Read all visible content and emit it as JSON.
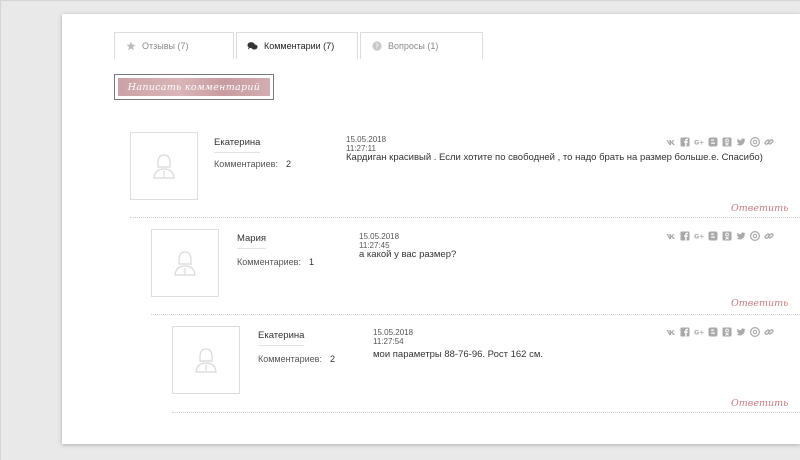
{
  "tabs": [
    {
      "label": "Отзывы (7)",
      "icon": "star-icon",
      "active": false
    },
    {
      "label": "Комментарии (7)",
      "icon": "chat-icon",
      "active": true
    },
    {
      "label": "Вопросы (1)",
      "icon": "question-icon",
      "active": false
    }
  ],
  "write_button": {
    "label": "Написать комментарий"
  },
  "comments_count_label": "Комментариев:",
  "reply_label": "Ответить",
  "comments": [
    {
      "author": "Екатерина",
      "count": "2",
      "date": "15.05.2018 11:27:11",
      "text": "Кардиган красивый . Если хотите по свободней , то надо брать на размер больше.e. Спасибо)"
    },
    {
      "author": "Мария",
      "count": "1",
      "date": "15.05.2018 11:27:45",
      "text": "а какой у вас размер?"
    },
    {
      "author": "Екатерина",
      "count": "2",
      "date": "15.05.2018 11:27:54",
      "text": "мои параметры 88-76-96. Рост 162 см."
    }
  ],
  "share_icons": [
    "vk-icon",
    "facebook-icon",
    "google-plus-icon",
    "blogger-icon",
    "odnoklassniki-icon",
    "twitter-icon",
    "mail-icon",
    "link-icon"
  ],
  "colors": {
    "accent": "#c77b82",
    "button_bg": "#d0a8ac"
  }
}
